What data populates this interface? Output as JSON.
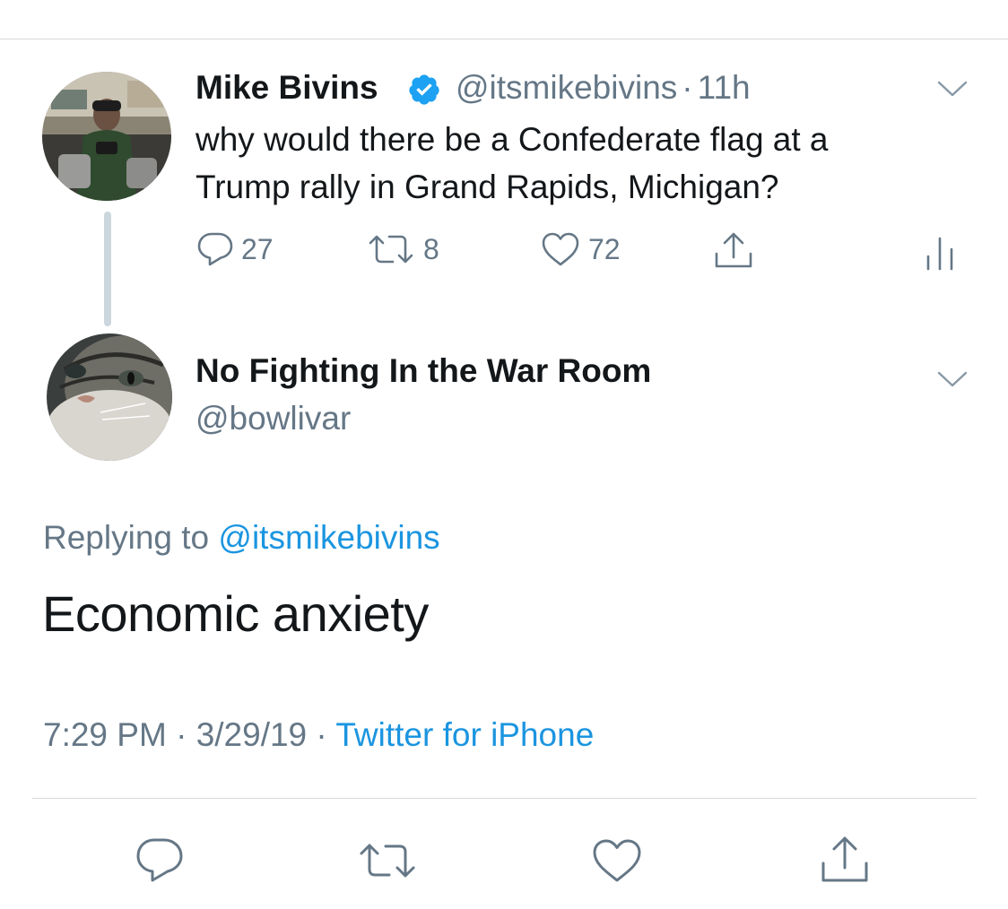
{
  "parent_tweet": {
    "display_name": "Mike Bivins",
    "handle": "@itsmikebivins",
    "separator": "·",
    "time_ago": "11h",
    "text_line1": "why would there be a Confederate flag at a",
    "text_line2": "Trump rally in Grand Rapids, Michigan?",
    "reply_count": "27",
    "retweet_count": "8",
    "like_count": "72"
  },
  "reply_tweet": {
    "display_name": "No Fighting In the War Room",
    "handle": "@bowlivar",
    "replying_prefix": "Replying to",
    "replying_handle": "@itsmikebivins",
    "text": "Economic anxiety",
    "time": "7:29 PM",
    "sep1": "·",
    "date": "3/29/19",
    "sep2": "·",
    "source": "Twitter for iPhone"
  },
  "colors": {
    "link_blue": "#1b95e0",
    "verified_blue": "#1da1f2",
    "secondary_gray": "#657786",
    "icon_gray": "#657786"
  },
  "icons": [
    "verified-badge-icon",
    "chevron-down-icon",
    "reply-icon",
    "retweet-icon",
    "like-icon",
    "share-icon",
    "analytics-icon"
  ]
}
